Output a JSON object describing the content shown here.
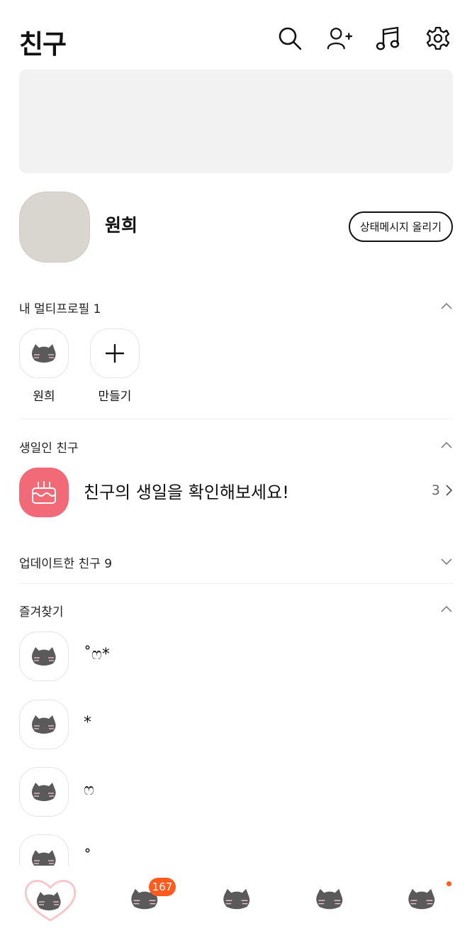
{
  "header": {
    "title": "친구",
    "icons": [
      "search-icon",
      "add-friend-icon",
      "music-icon",
      "settings-icon"
    ]
  },
  "profile": {
    "name": "원희",
    "status_button": "상태메시지 올리기"
  },
  "multi_profile": {
    "label": "내 멀티프로필 1",
    "items": [
      {
        "label": "원희"
      },
      {
        "label": "만들기"
      }
    ]
  },
  "birthday": {
    "label": "생일인 친구",
    "text": "친구의 생일을 확인해보세요!",
    "count": "3"
  },
  "updated": {
    "label": "업데이트한 친구 9"
  },
  "favorites": {
    "label": "즐겨찾기",
    "items": [
      {
        "name": "˚ෆ*"
      },
      {
        "name": "*"
      },
      {
        "name": "ෆ"
      },
      {
        "name": "˚"
      }
    ]
  },
  "tabbar": {
    "badge": "167",
    "accent": "#ff5b1f"
  },
  "colors": {
    "birthday_icon_bg": "#f26a78",
    "banner_bg": "#f2f2f2",
    "avatar_bg": "#d9d6cf"
  }
}
